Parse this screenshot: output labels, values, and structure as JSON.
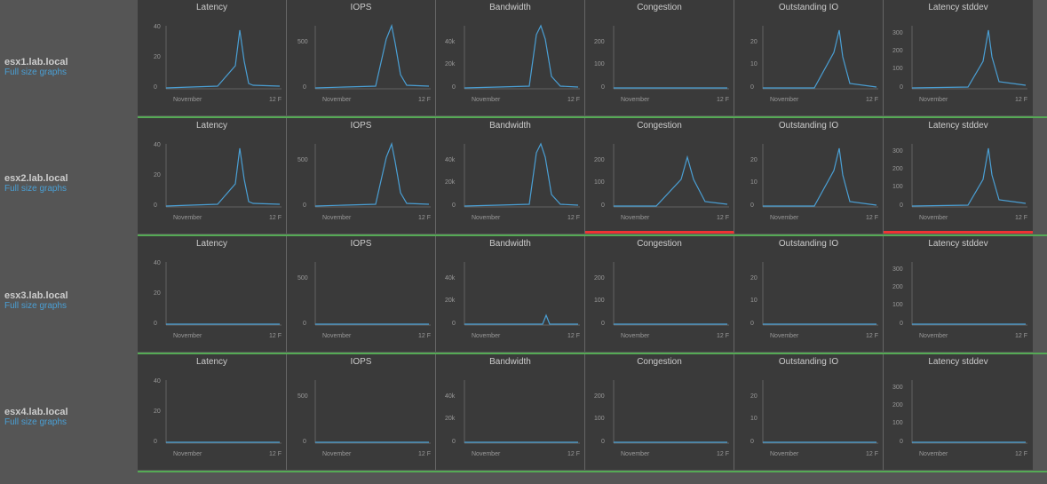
{
  "hosts": [
    {
      "name": "esx1.lab.local",
      "link": "Full size graphs",
      "alertRow": false
    },
    {
      "name": "esx2.lab.local",
      "link": "Full size graphs",
      "alertRow": true
    },
    {
      "name": "esx3.lab.local",
      "link": "Full size graphs",
      "alertRow": false
    },
    {
      "name": "esx4.lab.local",
      "link": "Full size graphs",
      "alertRow": false
    }
  ],
  "chartTitles": [
    "Latency",
    "IOPS",
    "Bandwidth",
    "Congestion",
    "Outstanding IO",
    "Latency stddev"
  ],
  "xLabels": [
    "November",
    "12 F"
  ],
  "yLabels": {
    "latency": [
      "40",
      "20",
      "0"
    ],
    "iops": [
      "500",
      "0"
    ],
    "bandwidth": [
      "40k",
      "20k",
      "0"
    ],
    "congestion": [
      "200",
      "100",
      "0"
    ],
    "outstandingIO": [
      "20",
      "10",
      "0"
    ],
    "latencyStddev": [
      "300",
      "200",
      "100",
      "0"
    ]
  }
}
